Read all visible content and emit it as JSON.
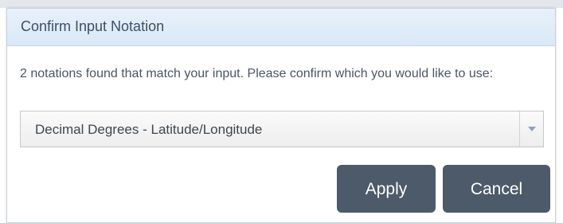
{
  "dialog": {
    "title": "Confirm Input Notation",
    "message": "2 notations found that match your input. Please confirm which you would like to use:",
    "select": {
      "selected_value": "Decimal Degrees - Latitude/Longitude",
      "arrow_icon": "chevron-down-icon"
    },
    "buttons": {
      "apply_label": "Apply",
      "cancel_label": "Cancel"
    }
  },
  "colors": {
    "title_bar_bg": "#dde9f7",
    "title_text": "#3d4f66",
    "button_bg": "#4d5a6a",
    "button_text": "#ffffff"
  }
}
